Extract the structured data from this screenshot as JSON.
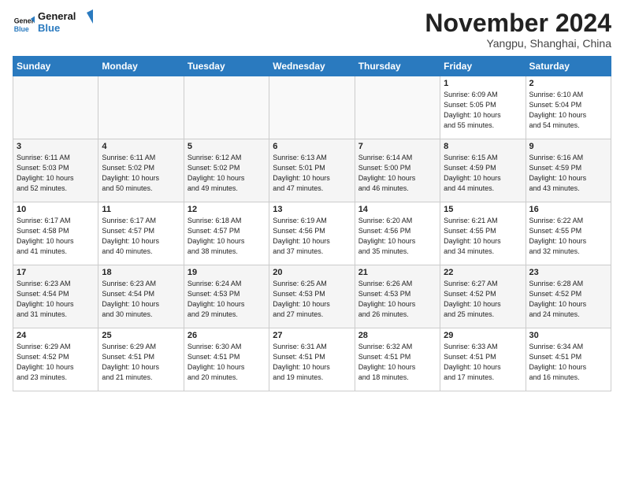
{
  "logo": {
    "line1": "General",
    "line2": "Blue"
  },
  "title": "November 2024",
  "subtitle": "Yangpu, Shanghai, China",
  "days_of_week": [
    "Sunday",
    "Monday",
    "Tuesday",
    "Wednesday",
    "Thursday",
    "Friday",
    "Saturday"
  ],
  "weeks": [
    [
      {
        "day": "",
        "info": ""
      },
      {
        "day": "",
        "info": ""
      },
      {
        "day": "",
        "info": ""
      },
      {
        "day": "",
        "info": ""
      },
      {
        "day": "",
        "info": ""
      },
      {
        "day": "1",
        "info": "Sunrise: 6:09 AM\nSunset: 5:05 PM\nDaylight: 10 hours\nand 55 minutes."
      },
      {
        "day": "2",
        "info": "Sunrise: 6:10 AM\nSunset: 5:04 PM\nDaylight: 10 hours\nand 54 minutes."
      }
    ],
    [
      {
        "day": "3",
        "info": "Sunrise: 6:11 AM\nSunset: 5:03 PM\nDaylight: 10 hours\nand 52 minutes."
      },
      {
        "day": "4",
        "info": "Sunrise: 6:11 AM\nSunset: 5:02 PM\nDaylight: 10 hours\nand 50 minutes."
      },
      {
        "day": "5",
        "info": "Sunrise: 6:12 AM\nSunset: 5:02 PM\nDaylight: 10 hours\nand 49 minutes."
      },
      {
        "day": "6",
        "info": "Sunrise: 6:13 AM\nSunset: 5:01 PM\nDaylight: 10 hours\nand 47 minutes."
      },
      {
        "day": "7",
        "info": "Sunrise: 6:14 AM\nSunset: 5:00 PM\nDaylight: 10 hours\nand 46 minutes."
      },
      {
        "day": "8",
        "info": "Sunrise: 6:15 AM\nSunset: 4:59 PM\nDaylight: 10 hours\nand 44 minutes."
      },
      {
        "day": "9",
        "info": "Sunrise: 6:16 AM\nSunset: 4:59 PM\nDaylight: 10 hours\nand 43 minutes."
      }
    ],
    [
      {
        "day": "10",
        "info": "Sunrise: 6:17 AM\nSunset: 4:58 PM\nDaylight: 10 hours\nand 41 minutes."
      },
      {
        "day": "11",
        "info": "Sunrise: 6:17 AM\nSunset: 4:57 PM\nDaylight: 10 hours\nand 40 minutes."
      },
      {
        "day": "12",
        "info": "Sunrise: 6:18 AM\nSunset: 4:57 PM\nDaylight: 10 hours\nand 38 minutes."
      },
      {
        "day": "13",
        "info": "Sunrise: 6:19 AM\nSunset: 4:56 PM\nDaylight: 10 hours\nand 37 minutes."
      },
      {
        "day": "14",
        "info": "Sunrise: 6:20 AM\nSunset: 4:56 PM\nDaylight: 10 hours\nand 35 minutes."
      },
      {
        "day": "15",
        "info": "Sunrise: 6:21 AM\nSunset: 4:55 PM\nDaylight: 10 hours\nand 34 minutes."
      },
      {
        "day": "16",
        "info": "Sunrise: 6:22 AM\nSunset: 4:55 PM\nDaylight: 10 hours\nand 32 minutes."
      }
    ],
    [
      {
        "day": "17",
        "info": "Sunrise: 6:23 AM\nSunset: 4:54 PM\nDaylight: 10 hours\nand 31 minutes."
      },
      {
        "day": "18",
        "info": "Sunrise: 6:23 AM\nSunset: 4:54 PM\nDaylight: 10 hours\nand 30 minutes."
      },
      {
        "day": "19",
        "info": "Sunrise: 6:24 AM\nSunset: 4:53 PM\nDaylight: 10 hours\nand 29 minutes."
      },
      {
        "day": "20",
        "info": "Sunrise: 6:25 AM\nSunset: 4:53 PM\nDaylight: 10 hours\nand 27 minutes."
      },
      {
        "day": "21",
        "info": "Sunrise: 6:26 AM\nSunset: 4:53 PM\nDaylight: 10 hours\nand 26 minutes."
      },
      {
        "day": "22",
        "info": "Sunrise: 6:27 AM\nSunset: 4:52 PM\nDaylight: 10 hours\nand 25 minutes."
      },
      {
        "day": "23",
        "info": "Sunrise: 6:28 AM\nSunset: 4:52 PM\nDaylight: 10 hours\nand 24 minutes."
      }
    ],
    [
      {
        "day": "24",
        "info": "Sunrise: 6:29 AM\nSunset: 4:52 PM\nDaylight: 10 hours\nand 23 minutes."
      },
      {
        "day": "25",
        "info": "Sunrise: 6:29 AM\nSunset: 4:51 PM\nDaylight: 10 hours\nand 21 minutes."
      },
      {
        "day": "26",
        "info": "Sunrise: 6:30 AM\nSunset: 4:51 PM\nDaylight: 10 hours\nand 20 minutes."
      },
      {
        "day": "27",
        "info": "Sunrise: 6:31 AM\nSunset: 4:51 PM\nDaylight: 10 hours\nand 19 minutes."
      },
      {
        "day": "28",
        "info": "Sunrise: 6:32 AM\nSunset: 4:51 PM\nDaylight: 10 hours\nand 18 minutes."
      },
      {
        "day": "29",
        "info": "Sunrise: 6:33 AM\nSunset: 4:51 PM\nDaylight: 10 hours\nand 17 minutes."
      },
      {
        "day": "30",
        "info": "Sunrise: 6:34 AM\nSunset: 4:51 PM\nDaylight: 10 hours\nand 16 minutes."
      }
    ]
  ]
}
